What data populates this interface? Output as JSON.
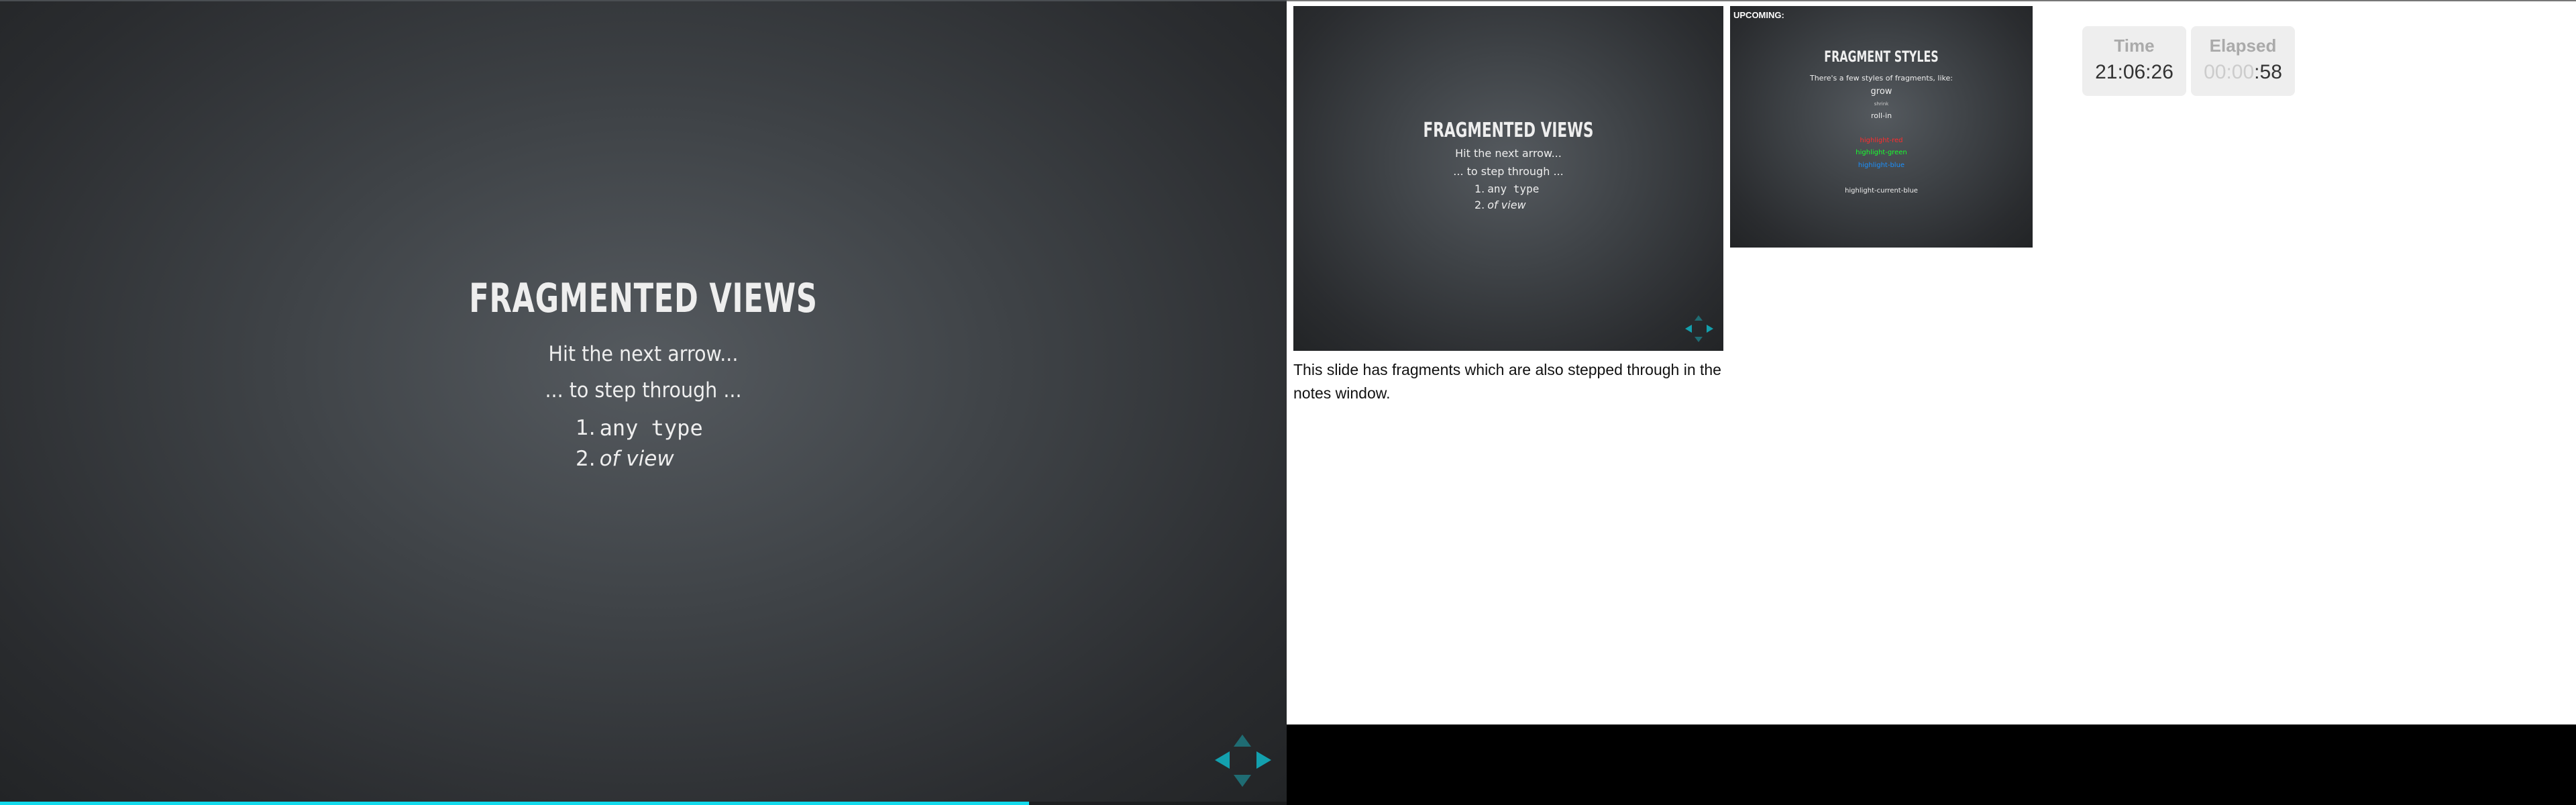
{
  "main_slide": {
    "title": "Fragmented Views",
    "line1": "Hit the next arrow...",
    "line2": "... to step through ...",
    "list": [
      {
        "number": "1.",
        "text": "any type"
      },
      {
        "number": "2.",
        "text": "of view"
      }
    ],
    "progress_fraction": 0.8
  },
  "controls": {
    "up_icon": "arrow-up-icon",
    "down_icon": "arrow-down-icon",
    "left_icon": "arrow-left-icon",
    "right_icon": "arrow-right-icon",
    "accent_color": "#13a0ae"
  },
  "current_preview": {
    "title": "Fragmented Views",
    "line1": "Hit the next arrow...",
    "line2": "... to step through ...",
    "list": [
      {
        "number": "1.",
        "text": "any type"
      },
      {
        "number": "2.",
        "text": "of view"
      }
    ]
  },
  "upcoming_preview": {
    "label": "UPCOMING:",
    "title": "Fragment Styles",
    "intro": "There's a few styles of fragments, like:",
    "grow": "grow",
    "shrink": "shrink",
    "roll_in": "roll-in",
    "highlight_red": "highlight-red",
    "highlight_green": "highlight-green",
    "highlight_blue": "highlight-blue",
    "highlight_current_blue": "highlight-current-blue"
  },
  "notes": {
    "text": "This slide has fragments which are also stepped through in the notes window."
  },
  "timers": {
    "time_label": "Time",
    "time_value": "21:06:26",
    "elapsed_label": "Elapsed",
    "elapsed_hidden": "00:00",
    "elapsed_seconds": ":58"
  }
}
